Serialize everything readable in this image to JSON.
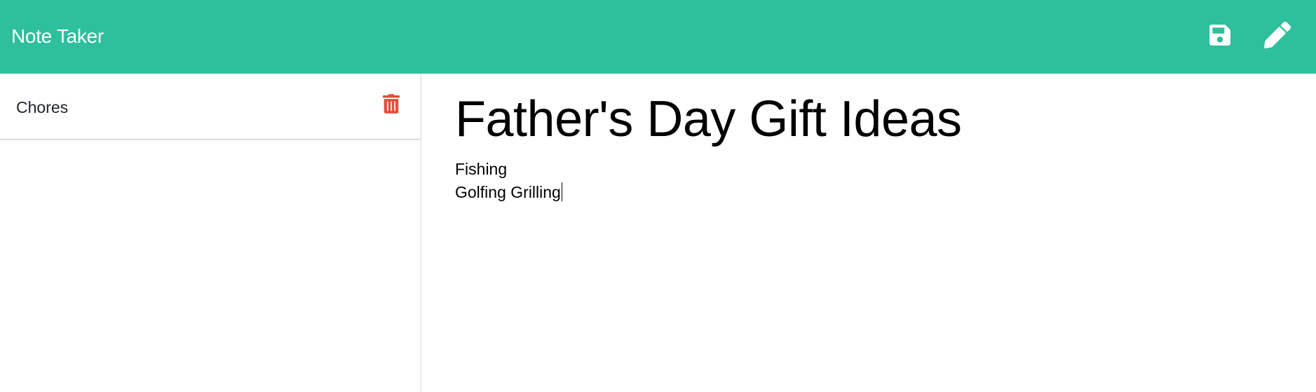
{
  "navbar": {
    "brand": "Note Taker",
    "background_color": "#2ebf9d",
    "save_icon": "floppy-disk-save-icon",
    "edit_icon": "pencil-edit-icon"
  },
  "sidebar": {
    "items": [
      {
        "title": "Chores",
        "delete_icon": "trash-icon",
        "delete_color": "#e74c3c"
      }
    ]
  },
  "note": {
    "title": "Father's Day Gift Ideas",
    "lines": [
      "Fishing",
      "Golfing Grilling"
    ]
  }
}
